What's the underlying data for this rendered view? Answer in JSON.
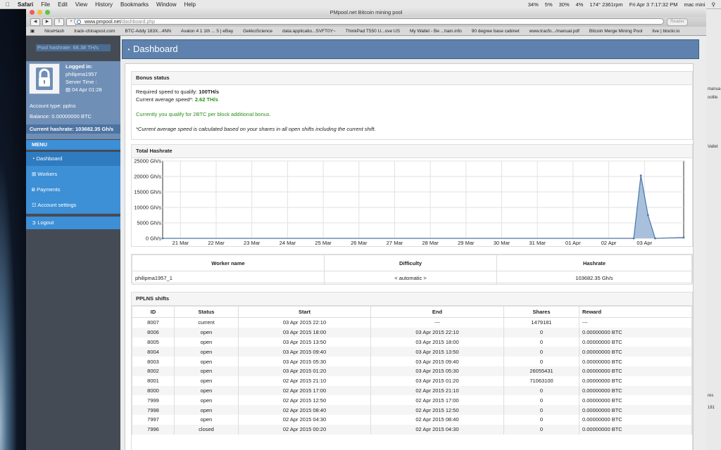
{
  "menubar": {
    "app": "Safari",
    "menus": [
      "File",
      "Edit",
      "View",
      "History",
      "Bookmarks",
      "Window",
      "Help"
    ],
    "status": [
      "34%",
      "5%",
      "30%",
      "4%",
      "174° 2361rpm"
    ],
    "clock": "Fri Apr 3   7:17:32 PM",
    "user": "mac mini"
  },
  "window": {
    "title": "PMpool.net Bitcoin mining pool",
    "url_host": "www.pmpool.net",
    "url_path": "/dashboard.php",
    "reader": "Reader"
  },
  "bookmarks": [
    "NiceHash",
    "track-chinapost.com",
    "BTC-Addy 183X...4NN",
    "Avalon 4 1 1th ... 5 | eBay",
    "GekkoScience",
    "data:applicatio...SVFT0Y~",
    "ThinkPad T550 U...ove US",
    "My Wallet - Be ...hain.info",
    "90 degree base cabinet",
    "www.tracfo.../manual.pdf",
    "Bitcoin Merge Mining Pool",
    "live | blockr.io"
  ],
  "desk_right": [
    "manua",
    "oolite",
    "Vallet",
    "res",
    "181"
  ],
  "sidebar": {
    "pool_hashrate": "Pool hashrate: 68.38 TH/s",
    "logged_in": "Logged in:",
    "username": "philipma1957",
    "server_time_label": "Server Time :",
    "server_time": "04 Apr 01:28",
    "account_type": "Account type: pplns",
    "balance": "Balance: 0.00000000 BTC",
    "current_hashrate": "Current hashrate: 103682.35 Gh/s",
    "menu_header": "MENU",
    "nav": [
      {
        "label": "Dashboard",
        "icon": "dashboard-icon",
        "glyph": "◔"
      },
      {
        "label": "Workers",
        "icon": "grid-icon",
        "glyph": "⊞"
      },
      {
        "label": "Payments",
        "icon": "bitcoin-icon",
        "glyph": "Ƀ"
      },
      {
        "label": "Account settings",
        "icon": "document-icon",
        "glyph": "☷"
      }
    ],
    "logout": "Logout"
  },
  "header": {
    "title": "Dashboard"
  },
  "bonus": {
    "title": "Bonus status",
    "required_label": "Required speed to qualify: ",
    "required_value": "100TH/s",
    "current_label": "Current average speed*: ",
    "current_value": "2.62 TH/s",
    "qualify": "Currently you qualify for 2BTC per block additional bonus.",
    "note": "*Current average speed is calculated based on your shares in all open shifts including the current shift."
  },
  "chart_data": {
    "type": "area",
    "title": "Total Hashrate",
    "ylabel": "",
    "xlabel": "",
    "ylim": [
      0,
      25000
    ],
    "yticks": [
      "0 Gh/s",
      "5000 Gh/s",
      "10000 Gh/s",
      "15000 Gh/s",
      "20000 Gh/s",
      "25000 Gh/s"
    ],
    "ytick_values": [
      0,
      5000,
      10000,
      15000,
      20000,
      25000
    ],
    "xlim": [
      0,
      14.6
    ],
    "xticks": [
      "21 Mar",
      "22 Mar",
      "23 Mar",
      "24 Mar",
      "25 Mar",
      "26 Mar",
      "27 Mar",
      "28 Mar",
      "29 Mar",
      "30 Mar",
      "31 Mar",
      "01 Apr",
      "02 Apr",
      "03 Apr"
    ],
    "grid": true,
    "fill_color": "#a9c0dc",
    "line_color": "#4a75a8",
    "points": [
      [
        0,
        0
      ],
      [
        13.2,
        0
      ],
      [
        13.4,
        20300
      ],
      [
        13.6,
        7500
      ],
      [
        13.8,
        0
      ],
      [
        14.6,
        300
      ]
    ]
  },
  "workers": {
    "headers": [
      "Worker name",
      "Difficulty",
      "Hashrate"
    ],
    "rows": [
      [
        "philipma1957_1",
        "< automatic >",
        "103682.35 Gh/s"
      ]
    ]
  },
  "shifts": {
    "title": "PPLNS shifts",
    "headers": [
      "ID",
      "Status",
      "Start",
      "End",
      "Shares",
      "Reward"
    ],
    "rows": [
      [
        "8007",
        "current",
        "03 Apr 2015 22:10",
        "---",
        "1479181",
        "---"
      ],
      [
        "8006",
        "open",
        "03 Apr 2015 18:00",
        "03 Apr 2015 22:10",
        "0",
        "0.00000000 BTC"
      ],
      [
        "8005",
        "open",
        "03 Apr 2015 13:50",
        "03 Apr 2015 18:00",
        "0",
        "0.00000000 BTC"
      ],
      [
        "8004",
        "open",
        "03 Apr 2015 09:40",
        "03 Apr 2015 13:50",
        "0",
        "0.00000000 BTC"
      ],
      [
        "8003",
        "open",
        "03 Apr 2015 05:30",
        "03 Apr 2015 09:40",
        "0",
        "0.00000000 BTC"
      ],
      [
        "8002",
        "open",
        "03 Apr 2015 01:20",
        "03 Apr 2015 05:30",
        "26055431",
        "0.00000000 BTC"
      ],
      [
        "8001",
        "open",
        "02 Apr 2015 21:10",
        "03 Apr 2015 01:20",
        "71063100",
        "0.00000000 BTC"
      ],
      [
        "8000",
        "open",
        "02 Apr 2015 17:00",
        "02 Apr 2015 21:10",
        "0",
        "0.00000000 BTC"
      ],
      [
        "7999",
        "open",
        "02 Apr 2015 12:50",
        "02 Apr 2015 17:00",
        "0",
        "0.00000000 BTC"
      ],
      [
        "7998",
        "open",
        "02 Apr 2015 08:40",
        "02 Apr 2015 12:50",
        "0",
        "0.00000000 BTC"
      ],
      [
        "7997",
        "open",
        "02 Apr 2015 04:30",
        "02 Apr 2015 08:40",
        "0",
        "0.00000000 BTC"
      ],
      [
        "7996",
        "closed",
        "02 Apr 2015 00:20",
        "02 Apr 2015 04:30",
        "0",
        "0.00000000 BTC"
      ]
    ]
  }
}
